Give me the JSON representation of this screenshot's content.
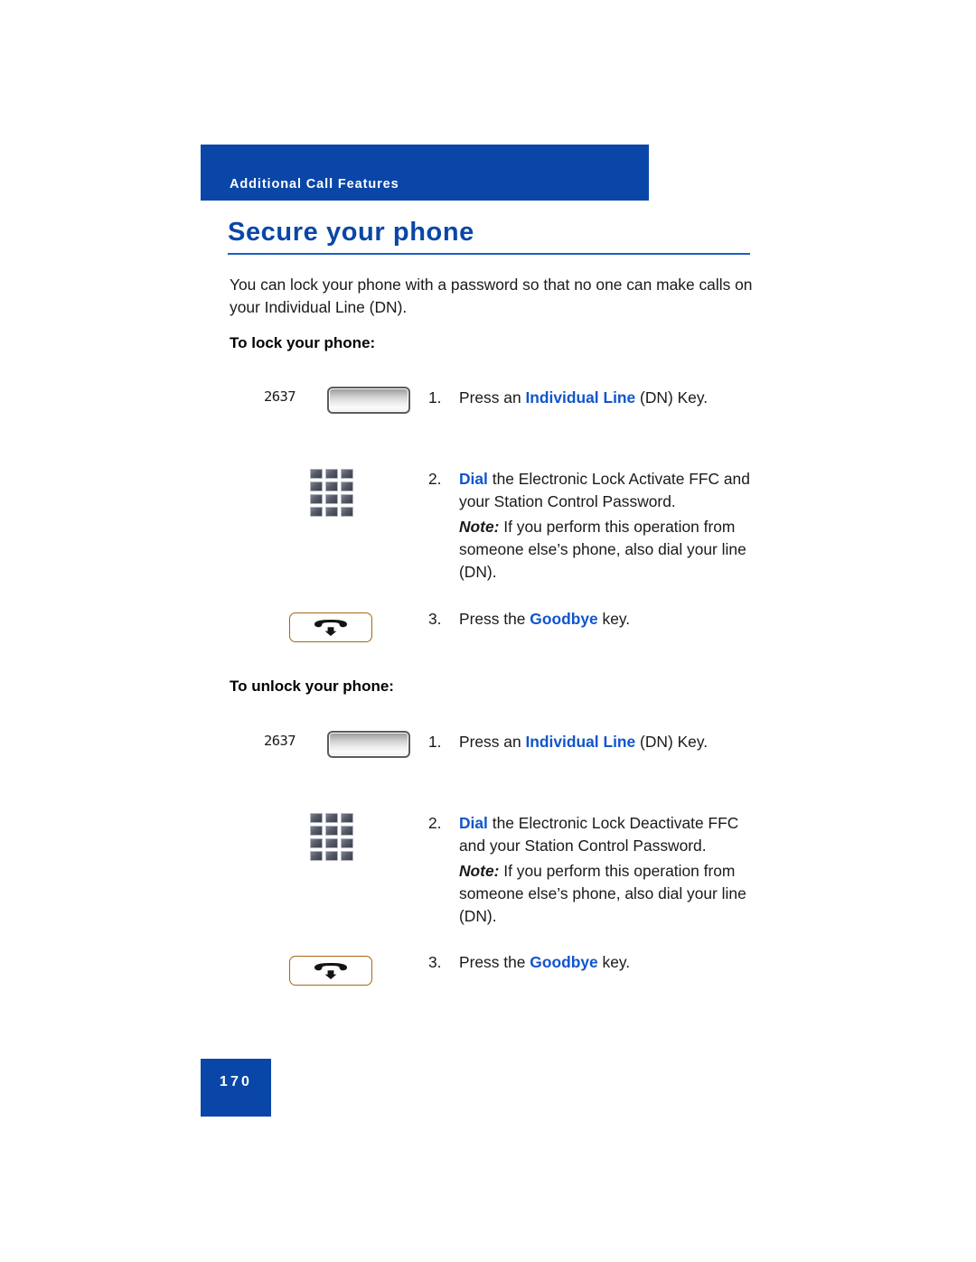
{
  "document": {
    "running_header": "Additional Call Features",
    "page_title": "Secure your phone",
    "page_number": "170",
    "colors": {
      "brand_blue": "#0A46A8",
      "keyword_blue": "#1155CC",
      "goodbye_orange": "#DD8F3C"
    }
  },
  "intro_paragraph": "You can lock your phone with a password so that no one can make calls on your Individual Line (DN).",
  "sections": [
    {
      "heading": "To lock your phone:",
      "steps": [
        {
          "number": "1.",
          "icon": "line-key",
          "dn_label": "2637",
          "text_before": "Press an ",
          "keyword": "Individual Line",
          "text_after": " (DN) Key."
        },
        {
          "number": "2.",
          "icon": "dialpad",
          "keyword": "Dial",
          "text_after": " the Electronic Lock Activate FFC and your Station Control Password.",
          "note_lead": "Note:",
          "note_text": " If you perform this operation from someone else’s phone, also dial your line (DN)."
        },
        {
          "number": "3.",
          "icon": "goodbye-key",
          "text_before": "Press the ",
          "keyword": "Goodbye",
          "text_after": " key."
        }
      ]
    },
    {
      "heading": "To unlock your phone:",
      "steps": [
        {
          "number": "1.",
          "icon": "line-key",
          "dn_label": "2637",
          "text_before": "Press an ",
          "keyword": "Individual Line",
          "text_after": " (DN) Key."
        },
        {
          "number": "2.",
          "icon": "dialpad",
          "keyword": "Dial",
          "text_after": " the Electronic Lock Deactivate FFC and your Station Control Password.",
          "note_lead": "Note:",
          "note_text": " If you perform this operation from someone else’s phone, also dial your line (DN)."
        },
        {
          "number": "3.",
          "icon": "goodbye-key",
          "text_before": "Press the ",
          "keyword": "Goodbye",
          "text_after": " key."
        }
      ]
    }
  ]
}
